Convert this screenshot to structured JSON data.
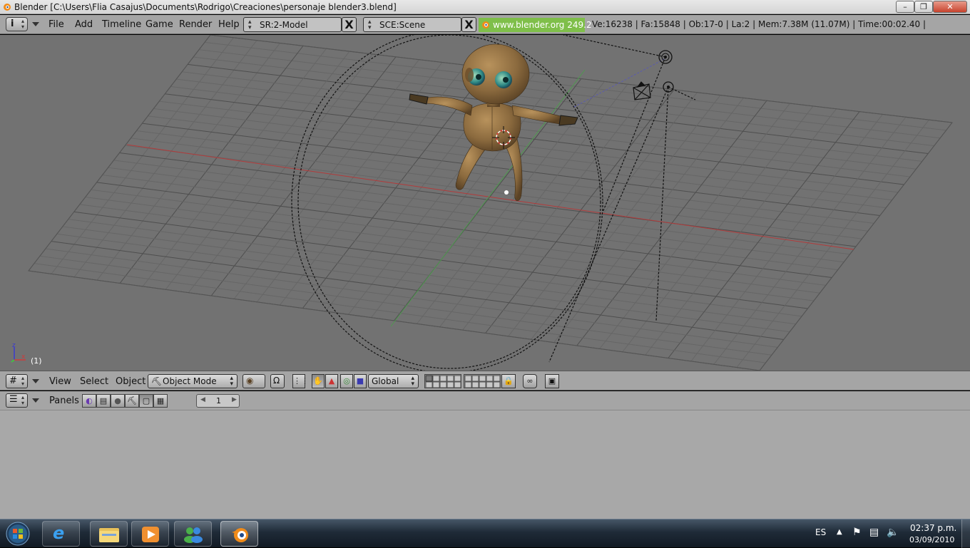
{
  "window": {
    "title": "Blender [C:\\Users\\Flia Casajus\\Documents\\Rodrigo\\Creaciones\\personaje blender3.blend]",
    "minimize_glyph": "–",
    "maximize_glyph": "❐",
    "close_glyph": "✕"
  },
  "top_menu": {
    "items": [
      "File",
      "Add",
      "Timeline",
      "Game",
      "Render",
      "Help"
    ],
    "screen_field": "SR:2-Model",
    "scene_field": "SCE:Scene",
    "close_glyph": "X",
    "blender_link": "www.blender.org 249.2",
    "stats": "Ve:16238 | Fa:15848 | Ob:17-0 | La:2  | Mem:7.38M (11.07M)  | Time:00:02.40 |"
  },
  "viewport": {
    "frame_label": "(1)",
    "axis_z": "z",
    "axis_x": "x",
    "colors": {
      "background": "#727272",
      "grid": "#5f5f5f",
      "x_axis": "#b33b3b",
      "y_axis": "#4f9a4f",
      "character": "#8b6a3e"
    }
  },
  "view_header": {
    "menu_items": [
      "View",
      "Select",
      "Object"
    ],
    "mode": "Object Mode",
    "orientation": "Global"
  },
  "buttons_header": {
    "menu_label": "Panels",
    "frame_value": "1",
    "left_arrow": "◀",
    "right_arrow": "▶"
  },
  "taskbar": {
    "language": "ES",
    "time": "02:37 p.m.",
    "date": "03/09/2010",
    "apps": [
      "internet-explorer",
      "windows-explorer",
      "media-player",
      "messenger",
      "blender"
    ]
  }
}
